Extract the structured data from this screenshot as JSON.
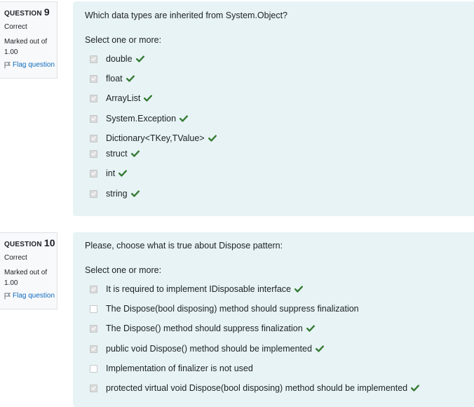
{
  "q9": {
    "label": "QUESTION",
    "number": "9",
    "state": "Correct",
    "grade": "Marked out of 1.00",
    "flag": "Flag question",
    "text": "Which data types are inherited from System.Object?",
    "prompt": "Select one or more:",
    "options": [
      {
        "label": "double",
        "checked": true,
        "correct": true
      },
      {
        "label": "float",
        "checked": true,
        "correct": true
      },
      {
        "label": "ArrayList",
        "checked": true,
        "correct": true
      },
      {
        "label": "System.Exception",
        "checked": true,
        "correct": true
      },
      {
        "label": "Dictionary<TKey,TValue>",
        "checked": true,
        "correct": true
      },
      {
        "label": "struct",
        "checked": true,
        "correct": true
      },
      {
        "label": "int",
        "checked": true,
        "correct": true
      },
      {
        "label": "string",
        "checked": true,
        "correct": true
      }
    ]
  },
  "q10": {
    "label": "QUESTION",
    "number": "10",
    "state": "Correct",
    "grade": "Marked out of 1.00",
    "flag": "Flag question",
    "text": "Please, choose what is true about Dispose pattern:",
    "prompt": "Select one or more:",
    "options": [
      {
        "label": "It is required to implement IDisposable interface",
        "checked": true,
        "correct": true
      },
      {
        "label": "The Dispose(bool disposing) method should suppress finalization",
        "checked": false,
        "correct": false
      },
      {
        "label": "The Dispose() method should suppress finalization",
        "checked": true,
        "correct": true
      },
      {
        "label": "public void Dispose() method should be implemented",
        "checked": true,
        "correct": true
      },
      {
        "label": "Implementation of finalizer is not used",
        "checked": false,
        "correct": false
      },
      {
        "label": "protected virtual void Dispose(bool disposing) method should be implemented",
        "checked": true,
        "correct": true
      }
    ]
  },
  "colors": {
    "info_bg": "#f8f9fa",
    "content_bg": "#e7f3f5",
    "correct_tick": "#357a32",
    "flag_link": "#0f6cbf"
  },
  "icons": {
    "flag": "flag-icon",
    "tick": "check-icon"
  }
}
